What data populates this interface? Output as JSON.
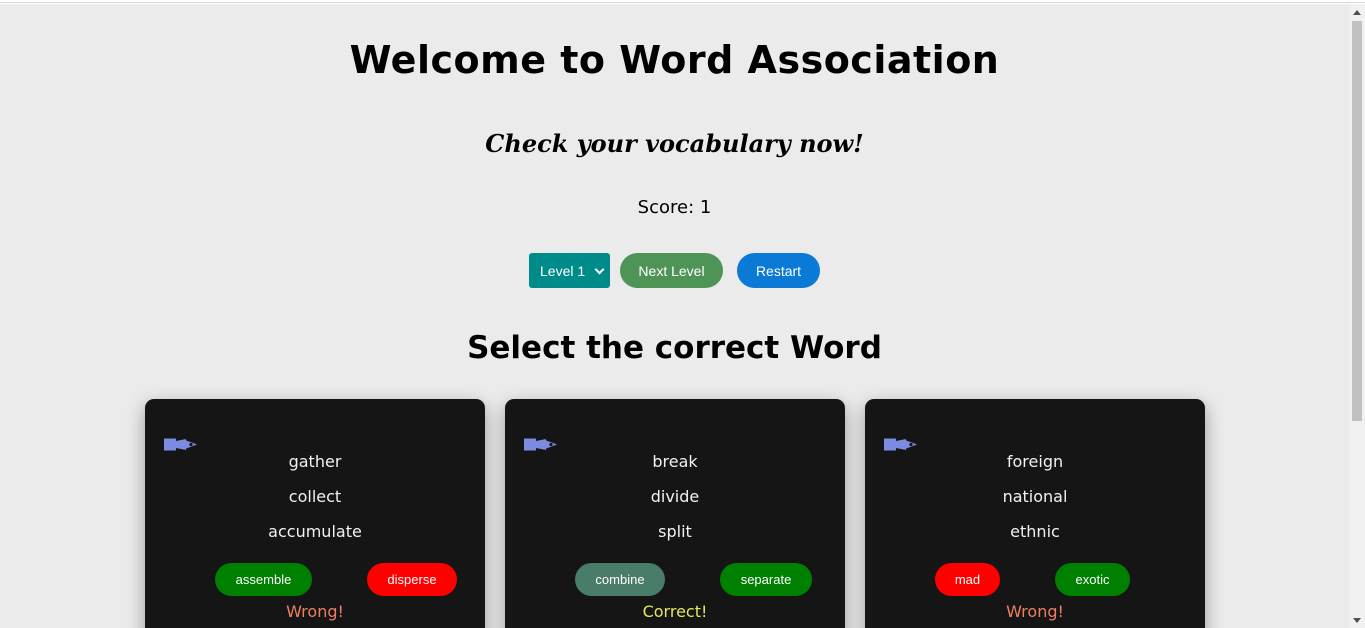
{
  "header": {
    "title": "Welcome to Word Association",
    "subtitle": "Check your vocabulary now!",
    "score_text": "Score: 1"
  },
  "controls": {
    "level_select_value": "Level 1",
    "next_level_label": "Next Level",
    "restart_label": "Restart"
  },
  "section_title": "Select the correct Word",
  "cards": [
    {
      "words": [
        "gather",
        "collect",
        "accumulate"
      ],
      "options": [
        {
          "label": "assemble",
          "color": "#008000"
        },
        {
          "label": "disperse",
          "color": "#ff0000"
        }
      ],
      "result": "Wrong!",
      "result_color": "#ef7f5e"
    },
    {
      "words": [
        "break",
        "divide",
        "split"
      ],
      "options": [
        {
          "label": "combine",
          "color": "#4a7c6a"
        },
        {
          "label": "separate",
          "color": "#008000"
        }
      ],
      "result": "Correct!",
      "result_color": "#e6e65a"
    },
    {
      "words": [
        "foreign",
        "national",
        "ethnic"
      ],
      "options": [
        {
          "label": "mad",
          "color": "#ff0000"
        },
        {
          "label": "exotic",
          "color": "#008000"
        }
      ],
      "result": "Wrong!",
      "result_color": "#ef7f5e"
    }
  ],
  "colors": {
    "page_background": "#ebebeb",
    "card_background": "#151515",
    "level_select": "#008b8b",
    "next_level_button": "#4f9457",
    "restart_button": "#0b79d6",
    "audio_icon": "#7b8be0"
  },
  "icons": {
    "audio": "speaker-icon"
  }
}
